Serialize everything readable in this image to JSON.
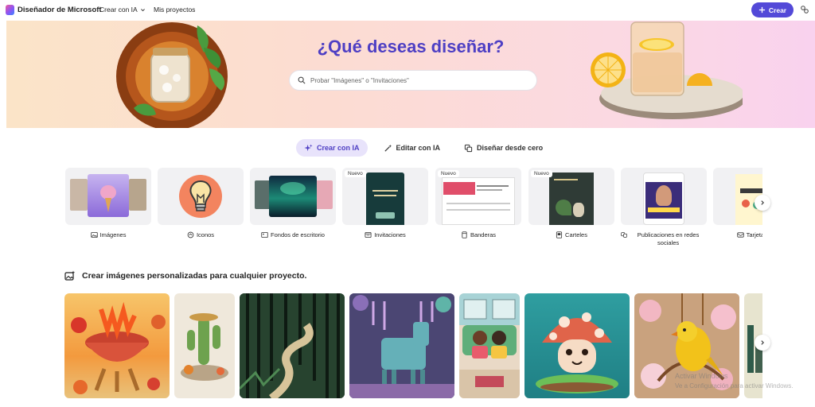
{
  "app": {
    "brand": "Diseñador de Microsoft",
    "nav": {
      "create_ai": "Crear con IA",
      "my_projects": "Mis proyectos"
    },
    "create_button": "Crear"
  },
  "hero": {
    "title": "¿Qué deseas diseñar?",
    "search_placeholder": "Probar \"Imágenes\" o \"Invitaciones\""
  },
  "tabs": [
    {
      "label": "Crear con IA",
      "icon": "sparkle-icon",
      "active": true
    },
    {
      "label": "Editar con IA",
      "icon": "magic-wand-icon",
      "active": false
    },
    {
      "label": "Diseñar desde cero",
      "icon": "design-icon",
      "active": false
    }
  ],
  "categories": [
    {
      "label": "Imágenes",
      "icon": "image-icon",
      "badge": ""
    },
    {
      "label": "Iconos",
      "icon": "icons-icon",
      "badge": ""
    },
    {
      "label": "Fondos de escritorio",
      "icon": "wallpaper-icon",
      "badge": ""
    },
    {
      "label": "Invitaciones",
      "icon": "invitation-icon",
      "badge": "Nuevo"
    },
    {
      "label": "Banderas",
      "icon": "banner-icon",
      "badge": "Nuevo"
    },
    {
      "label": "Carteles",
      "icon": "poster-icon",
      "badge": "Nuevo"
    },
    {
      "label": "Publicaciones en redes sociales",
      "icon": "social-post-icon",
      "badge": ""
    },
    {
      "label": "Tarjetas de",
      "icon": "card-icon",
      "badge": ""
    }
  ],
  "section": {
    "title": "Crear imágenes personalizadas para cualquier proyecto."
  },
  "watermark": {
    "line1": "Activar Windows",
    "line2": "Ve a Configuración para activar Windows."
  },
  "colors": {
    "accent": "#5349d8",
    "title": "#4e3fc4",
    "active_tab_bg": "#e8e3fb"
  }
}
